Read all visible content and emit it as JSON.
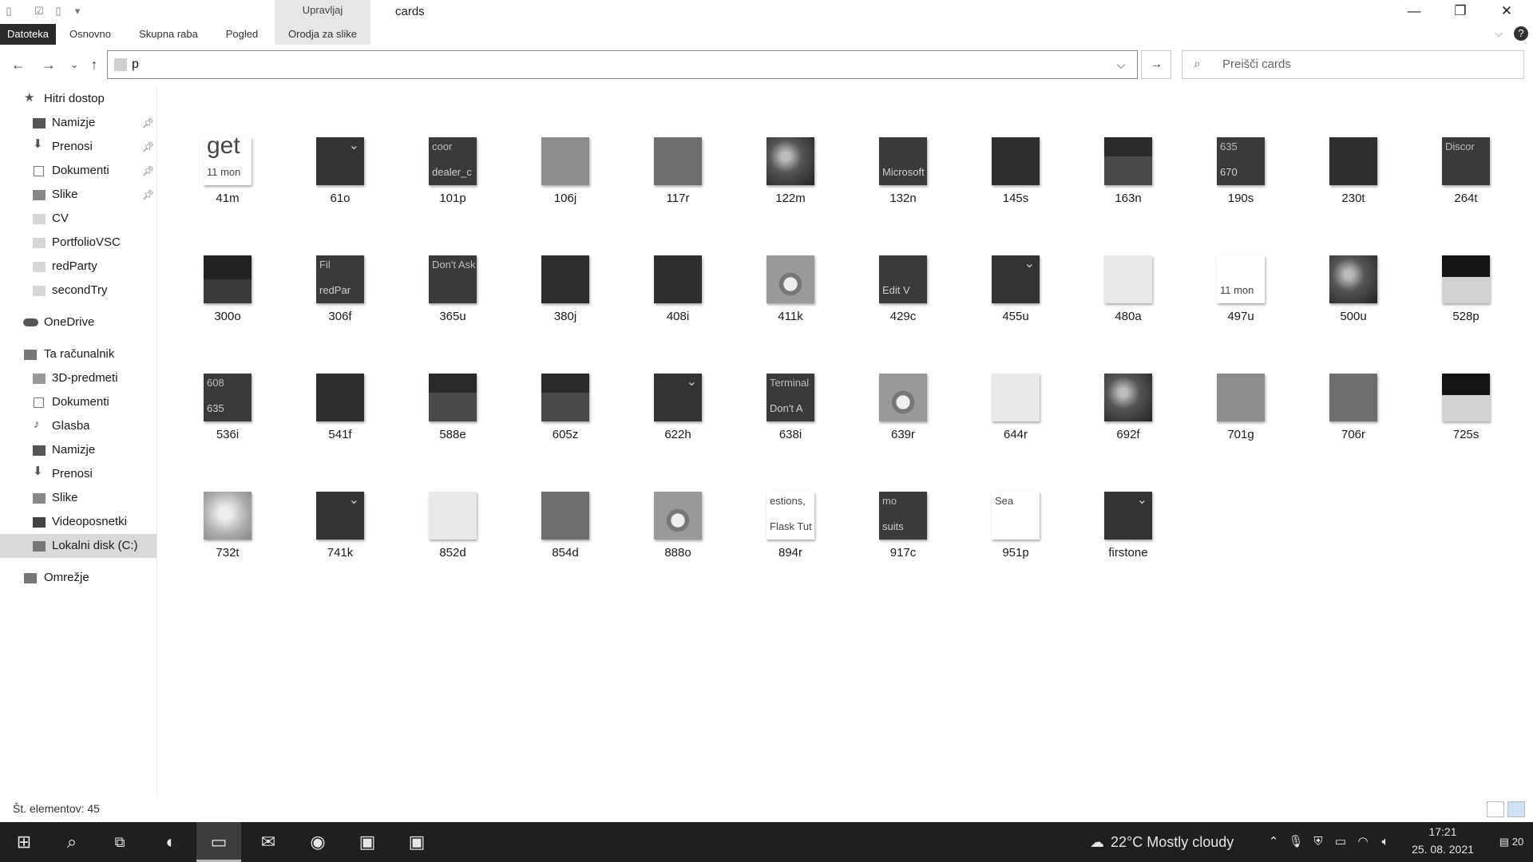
{
  "window": {
    "title": "cards",
    "contextual_tab": "Upravljaj",
    "minimize_icon": "—",
    "restore_icon": "❐",
    "close_icon": "✕"
  },
  "ribbon": {
    "tabs": [
      "Datoteka",
      "Osnovno",
      "Skupna raba",
      "Pogled",
      "Orodja za slike"
    ]
  },
  "address": {
    "value": "p",
    "search_placeholder": "Preišči cards"
  },
  "sidebar": {
    "quick_access": "Hitri dostop",
    "quick_items": [
      "Namizje",
      "Prenosi",
      "Dokumenti",
      "Slike",
      "CV",
      "PortfolioVSC",
      "redParty",
      "secondTry"
    ],
    "onedrive": "OneDrive",
    "this_pc": "Ta računalnik",
    "pc_items": [
      "3D-predmeti",
      "Dokumenti",
      "Glasba",
      "Namizje",
      "Prenosi",
      "Slike",
      "Videoposnetki",
      "Lokalni disk (C:)"
    ],
    "network": "Omrežje"
  },
  "files": [
    {
      "name": "41m",
      "kind": "text",
      "text": "get",
      "sub": "11 mon"
    },
    {
      "name": "61o",
      "kind": "dark-chevron"
    },
    {
      "name": "101p",
      "kind": "text-dark",
      "text": "coor",
      "sub": "dealer_c"
    },
    {
      "name": "106j",
      "kind": "gray"
    },
    {
      "name": "117r",
      "kind": "midgray"
    },
    {
      "name": "122m",
      "kind": "photo"
    },
    {
      "name": "132n",
      "kind": "text-dark",
      "text": "",
      "sub": "Microsoft"
    },
    {
      "name": "145s",
      "kind": "dark"
    },
    {
      "name": "163n",
      "kind": "split"
    },
    {
      "name": "190s",
      "kind": "text-dark",
      "text": "635",
      "sub": "670"
    },
    {
      "name": "230t",
      "kind": "dark"
    },
    {
      "name": "264t",
      "kind": "text-dark",
      "text": "Discor",
      "sub": ""
    },
    {
      "name": "300o",
      "kind": "split-dark"
    },
    {
      "name": "306f",
      "kind": "text-dark",
      "text": "Fil",
      "sub": "redPar"
    },
    {
      "name": "365u",
      "kind": "text-dark",
      "text": "Don't Ask",
      "sub": ""
    },
    {
      "name": "380j",
      "kind": "dark"
    },
    {
      "name": "408i",
      "kind": "dark"
    },
    {
      "name": "411k",
      "kind": "circle"
    },
    {
      "name": "429c",
      "kind": "text-dark",
      "text": "",
      "sub": "Edit V"
    },
    {
      "name": "455u",
      "kind": "dark-chevron"
    },
    {
      "name": "480a",
      "kind": "light"
    },
    {
      "name": "497u",
      "kind": "text",
      "text": "",
      "sub": "11 mon"
    },
    {
      "name": "500u",
      "kind": "photo"
    },
    {
      "name": "528p",
      "kind": "black-light"
    },
    {
      "name": "536i",
      "kind": "text-dark",
      "text": "608",
      "sub": "635"
    },
    {
      "name": "541f",
      "kind": "dark"
    },
    {
      "name": "588e",
      "kind": "split"
    },
    {
      "name": "605z",
      "kind": "split"
    },
    {
      "name": "622h",
      "kind": "dark-chevron"
    },
    {
      "name": "638i",
      "kind": "text-dark",
      "text": "Terminal",
      "sub": "Don't A"
    },
    {
      "name": "639r",
      "kind": "circle"
    },
    {
      "name": "644r",
      "kind": "light"
    },
    {
      "name": "692f",
      "kind": "photo"
    },
    {
      "name": "701g",
      "kind": "gray"
    },
    {
      "name": "706r",
      "kind": "midgray"
    },
    {
      "name": "725s",
      "kind": "black-light"
    },
    {
      "name": "732t",
      "kind": "photo-light"
    },
    {
      "name": "741k",
      "kind": "dark-chevron"
    },
    {
      "name": "852d",
      "kind": "light"
    },
    {
      "name": "854d",
      "kind": "midgray"
    },
    {
      "name": "888o",
      "kind": "circle"
    },
    {
      "name": "894r",
      "kind": "text",
      "text": "estions,",
      "sub": "Flask Tut"
    },
    {
      "name": "917c",
      "kind": "text-dark",
      "text": "mo",
      "sub": "suits"
    },
    {
      "name": "951p",
      "kind": "text",
      "text": "Sea",
      "sub": ""
    },
    {
      "name": "firstone",
      "kind": "dark-chevron"
    }
  ],
  "status": {
    "count": "Št. elementov: 45"
  },
  "taskbar": {
    "weather": "22°C  Mostly cloudy",
    "time": "17:21",
    "date": "25. 08. 2021",
    "notifications": "20"
  }
}
